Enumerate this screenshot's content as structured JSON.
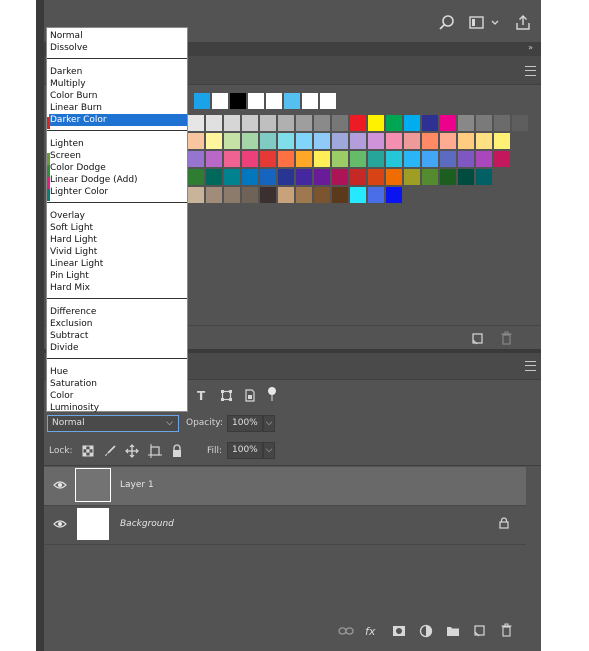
{
  "blend_menu": {
    "groups": [
      [
        "Normal",
        "Dissolve"
      ],
      [
        "Darken",
        "Multiply",
        "Color Burn",
        "Linear Burn",
        "Darker Color"
      ],
      [
        "Lighten",
        "Screen",
        "Color Dodge",
        "Linear Dodge (Add)",
        "Lighter Color"
      ],
      [
        "Overlay",
        "Soft Light",
        "Hard Light",
        "Vivid Light",
        "Linear Light",
        "Pin Light",
        "Hard Mix"
      ],
      [
        "Difference",
        "Exclusion",
        "Subtract",
        "Divide"
      ],
      [
        "Hue",
        "Saturation",
        "Color",
        "Luminosity"
      ]
    ],
    "highlighted": "Darker Color",
    "highlight_color": "#1e73d2"
  },
  "swatches": {
    "rows": [
      [
        "#1aa3e8",
        "#ffffff",
        "#000000",
        "#ffffff",
        "#ffffff",
        "#55bff0",
        "#ffffff",
        "#ffffff"
      ],
      [
        "#e6e6e6",
        "#e0e0e0",
        "#d6d6d6",
        "#cccccc",
        "#bfbfbf",
        "#b0b0b0",
        "#9e9e9e",
        "#8a8a8a",
        "#777777",
        "#ed1c24",
        "#fff200",
        "#00a651",
        "#00aeef",
        "#2e3192",
        "#ec008c",
        "#888888",
        "#7a7a7a",
        "#6b6b6b",
        "#5e5e5e"
      ],
      [
        "#f7c59f",
        "#fff59d",
        "#c5e1a5",
        "#a5d6a7",
        "#80cbc4",
        "#80deea",
        "#81d4fa",
        "#90caf9",
        "#9fa8da",
        "#b39ddb",
        "#ce93d8",
        "#f48fb1",
        "#ef9a9a",
        "#ff8a65",
        "#ffab91",
        "#ffcc80",
        "#ffe082",
        "#fff176"
      ],
      [
        "#9575cd",
        "#ba68c8",
        "#f06292",
        "#ec407a",
        "#e53935",
        "#ff7043",
        "#ffa726",
        "#ffee58",
        "#9ccc65",
        "#66bb6a",
        "#26a69a",
        "#26c6da",
        "#29b6f6",
        "#42a5f5",
        "#5c6bc0",
        "#7e57c2",
        "#ab47bc",
        "#c2185b"
      ],
      [
        "#2e7d32",
        "#00695c",
        "#00838f",
        "#0277bd",
        "#1565c0",
        "#283593",
        "#4527a0",
        "#6a1b9a",
        "#ad1457",
        "#c62828",
        "#d84315",
        "#ef6c00",
        "#9e9d24",
        "#558b2f",
        "#1b5e20",
        "#004d40",
        "#006064"
      ],
      [
        "#c8b49a",
        "#a08c78",
        "#8c7b6b",
        "#6f6257",
        "#3c2f2f",
        "#c8a27a",
        "#a07850",
        "#7a5530",
        "#5a3a1a",
        "#26e8ff",
        "#4a6ee8",
        "#0a14f0"
      ]
    ]
  },
  "layers_panel": {
    "blend_mode": "Normal",
    "opacity_label": "Opacity:",
    "opacity_value": "100%",
    "lock_label": "Lock:",
    "fill_label": "Fill:",
    "fill_value": "100%",
    "layers": [
      {
        "name": "Layer 1",
        "italic": false,
        "locked": false,
        "selected": true
      },
      {
        "name": "Background",
        "italic": true,
        "locked": true,
        "selected": false
      }
    ],
    "footer_fx": "fx"
  },
  "colors": {
    "panel": "#535353",
    "panel_dark": "#3a3a3a",
    "selected_layer": "#696969"
  }
}
